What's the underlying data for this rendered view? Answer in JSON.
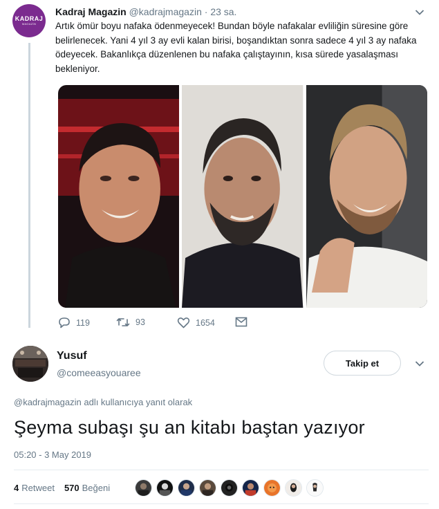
{
  "parent_tweet": {
    "avatar": {
      "line1": "KADRAJ",
      "line2": "MAGAZİN",
      "color": "#7b2b8f"
    },
    "display_name": "Kadraj Magazin",
    "handle": "@kadrajmagazin",
    "dot": "·",
    "time": "23 sa.",
    "text": "Artık ömür boyu nafaka ödenmeyecek! Bundan böyle nafakalar evliliğin süresine göre belirlenecek. Yani 4 yıl 3 ay evli kalan birisi, boşandıktan sonra sadece 4 yıl 3 ay nafaka ödeyecek. Bakanlıkça düzenlenen bu nafaka çalıştayının, kısa sürede yasalaşması bekleniyor.",
    "photos": [
      "photo-1",
      "photo-2",
      "photo-3"
    ],
    "actions": {
      "reply": {
        "icon": "reply-icon",
        "count": "119"
      },
      "retweet": {
        "icon": "retweet-icon",
        "count": "93"
      },
      "like": {
        "icon": "heart-icon",
        "count": "1654"
      },
      "message": {
        "icon": "mail-icon"
      }
    }
  },
  "reply_tweet": {
    "display_name": "Yusuf",
    "handle": "@comeeasyouaree",
    "follow_label": "Takip et",
    "reply_to": {
      "mention": "@kadrajmagazin",
      "suffix": " adlı kullanıcıya yanıt olarak"
    },
    "text": "Şeyma subaşı şu an kitabı baştan yazıyor",
    "timestamp": "05:20 - 3 May 2019",
    "stats": {
      "retweets": {
        "count": "4",
        "label": "Retweet"
      },
      "likes": {
        "count": "570",
        "label": "Beğeni"
      }
    },
    "liker_avatar_count": 9
  },
  "colors": {
    "text": "#14171a",
    "secondary": "#657786",
    "divider": "#e6ecf0",
    "thread": "#ccd6dd"
  }
}
